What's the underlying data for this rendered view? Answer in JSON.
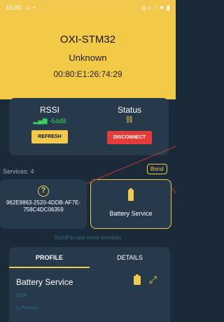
{
  "status_bar": {
    "time": "15:00",
    "left_icons": "☺ •",
    "right_icons": "◎ ◐ ↑ ▼ ▮"
  },
  "device": {
    "name": "OXI-STM32",
    "state": "Unknown",
    "mac": "00:80:E1:26:74:29"
  },
  "rssi": {
    "label": "RSSI",
    "value": "-54dB",
    "button": "REFRESH"
  },
  "status": {
    "label": "Status",
    "button": "DISCONNECT"
  },
  "services": {
    "count_label": "Services: 4",
    "bond_label": "Bond",
    "items": [
      {
        "uuid": "962E9863-2520-4DDB-AF7E-758C4DC06359"
      },
      {
        "name": "Battery Service"
      }
    ],
    "scroll_hint": "Scroll to see more services"
  },
  "tabs": {
    "profile": "PROFILE",
    "details": "DETAILS"
  },
  "profile": {
    "title": "Battery Service",
    "uuid": "180F",
    "primary": "Is Primary"
  },
  "colors": {
    "accent": "#f2c94c",
    "background": "#1b2a38",
    "card": "#273a4c",
    "danger": "#e63b3b",
    "success": "#3ccf5d"
  }
}
